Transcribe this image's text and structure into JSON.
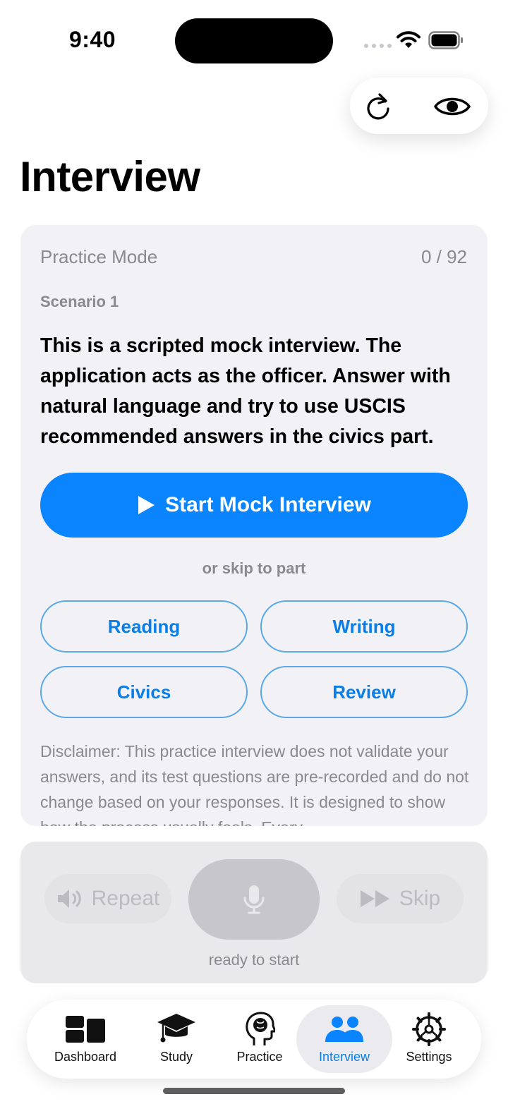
{
  "status_bar": {
    "time": "9:40"
  },
  "page": {
    "title": "Interview"
  },
  "card": {
    "mode_label": "Practice Mode",
    "progress": "0 / 92",
    "scenario_label": "Scenario 1",
    "intro_text": "This is a scripted mock interview. The application acts as the officer. Answer with natural language and try to use USCIS recommended answers in the civics part.",
    "start_button": "Start Mock Interview",
    "skip_label": "or skip to part",
    "parts": [
      "Reading",
      "Writing",
      "Civics",
      "Review"
    ],
    "disclaimer": "Disclaimer: This practice interview does not validate your answers, and its test questions are pre-recorded and do not change based on your responses. It is designed to show how the process usually feels. Every"
  },
  "controls": {
    "repeat_label": "Repeat",
    "skip_label": "Skip",
    "status": "ready to start"
  },
  "tabs": [
    {
      "label": "Dashboard",
      "icon": "dashboard-icon"
    },
    {
      "label": "Study",
      "icon": "graduation-cap-icon"
    },
    {
      "label": "Practice",
      "icon": "brain-head-icon"
    },
    {
      "label": "Interview",
      "icon": "people-icon",
      "selected": true
    },
    {
      "label": "Settings",
      "icon": "gear-icon"
    }
  ],
  "colors": {
    "accent": "#0a84ff",
    "card_bg": "#f1f1f6",
    "secondary_text": "#8a8a8e"
  }
}
